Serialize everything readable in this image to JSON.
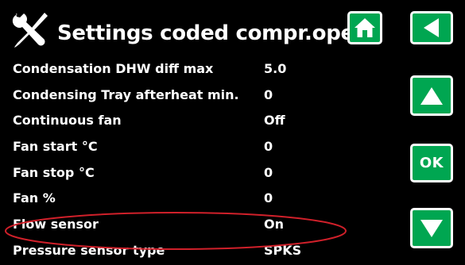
{
  "header": {
    "icon": "tools-icon",
    "title": "Settings coded compr.oper"
  },
  "nav": {
    "home_icon": "home-icon",
    "back_icon": "back-arrow-icon",
    "up_icon": "up-arrow-icon",
    "ok_label": "OK",
    "down_icon": "down-arrow-icon"
  },
  "settings": [
    {
      "label": "Condensation DHW diff max",
      "value": "5.0"
    },
    {
      "label": "Condensing Tray afterheat min.",
      "value": "0"
    },
    {
      "label": "Continuous fan",
      "value": "Off"
    },
    {
      "label": "Fan start °C",
      "value": "0"
    },
    {
      "label": "Fan stop °C",
      "value": "0"
    },
    {
      "label": "Fan %",
      "value": "0"
    },
    {
      "label": "Flow sensor",
      "value": "On"
    },
    {
      "label": "Pressure sensor type",
      "value": "SPKS"
    }
  ],
  "colors": {
    "background": "#000000",
    "text": "#ffffff",
    "button_fill": "#00a651",
    "button_border": "#ffffff",
    "highlight": "#d0202a"
  }
}
